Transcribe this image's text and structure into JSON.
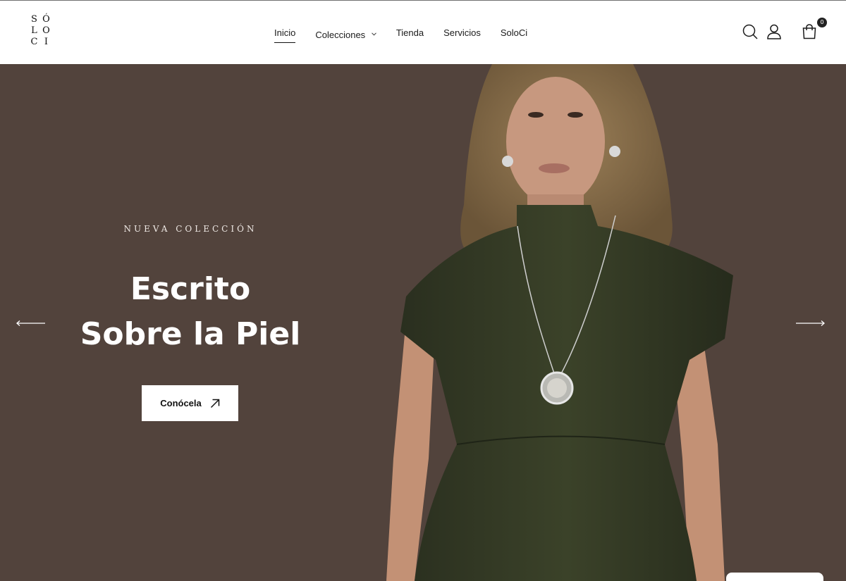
{
  "brand": {
    "logo_letters": [
      "S",
      "Ó",
      "L",
      "O",
      "C",
      "I"
    ]
  },
  "nav": {
    "items": [
      {
        "label": "Inicio",
        "active": true
      },
      {
        "label": "Colecciones",
        "has_dropdown": true
      },
      {
        "label": "Tienda"
      },
      {
        "label": "Servicios"
      },
      {
        "label": "SoloCi"
      }
    ]
  },
  "header_icons": {
    "search": "search-icon",
    "account": "user-icon",
    "cart": "shopping-bag-icon",
    "cart_count": "0"
  },
  "hero": {
    "eyebrow": "NUEVA COLECCIÓN",
    "title_line1": "Escrito",
    "title_line2": "Sobre la Piel",
    "cta_label": "Conócela",
    "cta_icon": "arrow-up-right-icon",
    "prev_icon": "arrow-left-icon",
    "next_icon": "arrow-right-icon",
    "background_color": "#52433c",
    "image": "model-green-dress-pendant-necklace"
  },
  "colors": {
    "header_bg": "#ffffff",
    "text": "#1a1a1a",
    "dress": "#333a26",
    "skin": "#c7987f"
  }
}
